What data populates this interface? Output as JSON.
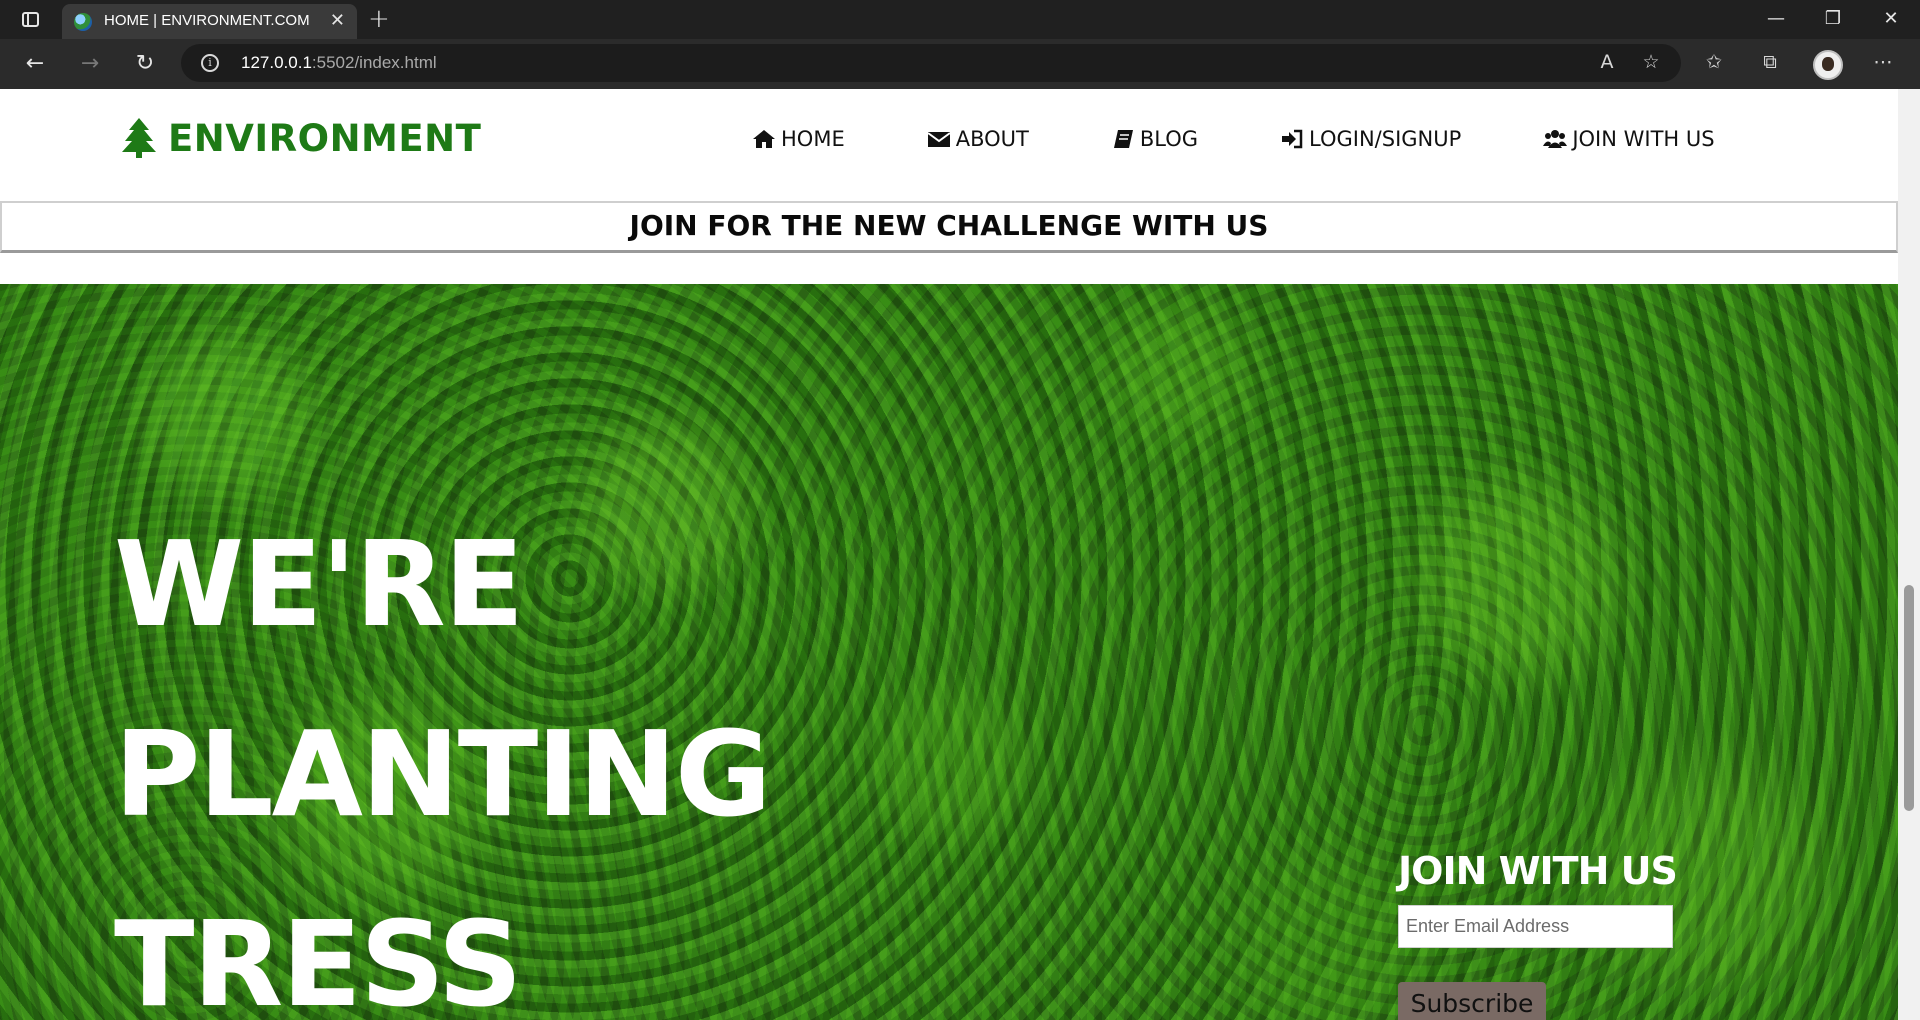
{
  "browser": {
    "tab_title": "HOME | ENVIRONMENT.COM",
    "tab_close": "✕",
    "new_tab": "+",
    "url_host": "127.0.0.1",
    "url_path": ":5502/index.html",
    "window_minimize": "—",
    "window_restore": "❐",
    "window_close": "✕"
  },
  "site": {
    "brand": "ENVIRONMENT",
    "nav": [
      {
        "label": "HOME",
        "icon": "home-icon"
      },
      {
        "label": "ABOUT",
        "icon": "envelope-icon"
      },
      {
        "label": "BLOG",
        "icon": "book-icon"
      },
      {
        "label": "LOGIN/SIGNUP",
        "icon": "sign-in-icon"
      },
      {
        "label": "JOIN WITH US",
        "icon": "users-icon"
      }
    ],
    "banner": "JOIN FOR THE NEW CHALLENGE WITH US"
  },
  "hero": {
    "lines": [
      "WE'RE",
      "PLANTING",
      "TRESS"
    ],
    "join_heading": "JOIN WITH US",
    "email_placeholder": "Enter Email Address",
    "subscribe_label": "Subscribe"
  },
  "colors": {
    "brand_green": "#1e7a16",
    "subscribe_bg": "#7a6a64"
  }
}
